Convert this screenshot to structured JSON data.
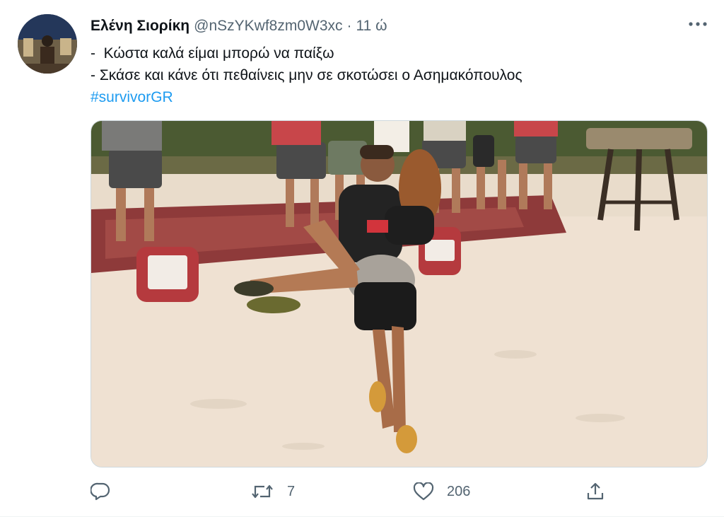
{
  "tweet": {
    "author_name": "Ελένη Σιορίκη",
    "handle": "@nSzYKwf8zm0W3xc",
    "separator": "·",
    "time": "11 ώ",
    "lines": [
      "-  Κώστα καλά είμαι μπορώ να παίξω",
      "- Σκάσε και κάνε ότι πεθαίνεις μην σε σκοτώσει ο Ασημακόπουλος"
    ],
    "hashtag": "#survivorGR"
  },
  "actions": {
    "reply_icon": "reply-icon",
    "retweet_icon": "retweet-icon",
    "retweet_count": "7",
    "like_icon": "heart-icon",
    "like_count": "206",
    "share_icon": "share-icon"
  },
  "colors": {
    "link": "#1d9bf0",
    "secondary_text": "#536471",
    "primary_text": "#0f1419"
  }
}
